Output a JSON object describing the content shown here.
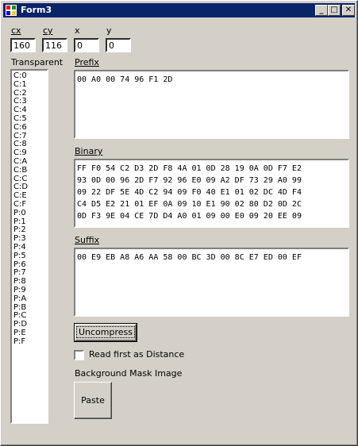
{
  "window": {
    "title": "Form3",
    "minimize": "_",
    "maximize": "□",
    "close": "✕"
  },
  "coords": {
    "cx_label": "cx",
    "cx_value": "160",
    "cy_label": "cy",
    "cy_value": "116",
    "x_label": "x",
    "x_value": "0",
    "y_label": "y",
    "y_value": "0"
  },
  "transparent": {
    "label": "Transparent",
    "items": [
      "C:0",
      "C:1",
      "C:2",
      "C:3",
      "C:4",
      "C:5",
      "C:6",
      "C:7",
      "C:8",
      "C:9",
      "C:A",
      "C:B",
      "C:C",
      "C:D",
      "C:E",
      "C:F",
      "P:0",
      "P:1",
      "P:2",
      "P:3",
      "P:4",
      "P:5",
      "P:6",
      "P:7",
      "P:8",
      "P:9",
      "P:A",
      "P:B",
      "P:C",
      "P:D",
      "P:E",
      "P:F"
    ]
  },
  "prefix": {
    "label": "Prefix",
    "text": "00 A0 00 74 96 F1 2D"
  },
  "binary": {
    "label": "Binary",
    "text": "FF F0 54 C2 D3 2D F8 4A 01 0D 28 19 0A 0D F7 E2\n93 0D 00 96 2D F7 92 96 E0 09 A2 DF 73 29 A0 99\n09 22 DF 5E 4D C2 94 09 F0 40 E1 01 02 DC 4D F4\nC4 D5 E2 21 01 EF 0A 09 10 E1 90 02 80 D2 0D 2C\n0D F3 9E 04 CE 7D D4 A0 01 09 00 E0 09 20 EE 09"
  },
  "suffix": {
    "label": "Suffix",
    "text": "00 E9 EB A8 A6 AA 58 00 BC 3D 00 8C E7 ED 00 EF"
  },
  "actions": {
    "uncompress": "Uncompress",
    "read_first_label": "Read first as Distance",
    "background_label": "Background Mask Image",
    "paste": "Paste"
  }
}
